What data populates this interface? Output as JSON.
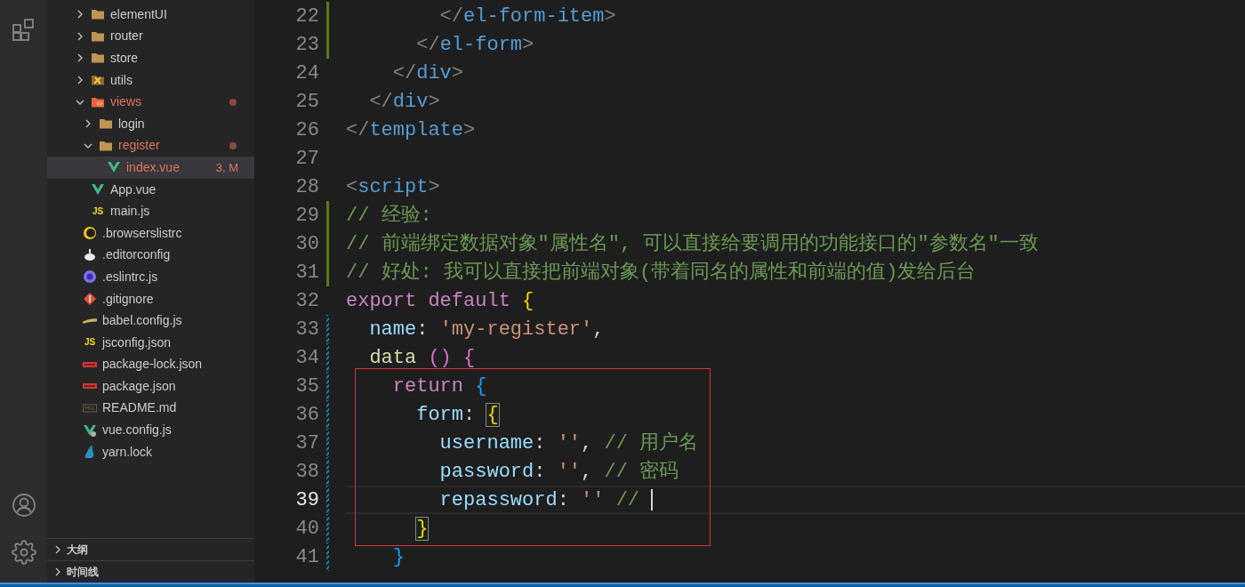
{
  "explorer": {
    "tree": [
      {
        "children": [
          {
            "name": "elementUI",
            "kind": "folder",
            "expanded": false,
            "selected": false,
            "has_problems": false
          },
          {
            "name": "router",
            "kind": "folder",
            "expanded": false,
            "selected": false,
            "has_problems": false
          },
          {
            "name": "store",
            "kind": "folder",
            "expanded": false,
            "selected": false,
            "has_problems": false
          },
          {
            "name": "utils",
            "kind": "tools-folder",
            "expanded": false,
            "selected": false,
            "has_problems": false
          },
          {
            "name": "views",
            "kind": "views-folder",
            "expanded": true,
            "selected": false,
            "has_problems": true,
            "children": [
              {
                "name": "login",
                "kind": "folder",
                "expanded": false,
                "selected": false,
                "has_problems": false
              },
              {
                "name": "register",
                "kind": "folder",
                "expanded": true,
                "selected": false,
                "has_problems": true,
                "children": [
                  {
                    "name": "index.vue",
                    "kind": "vue",
                    "selected": true,
                    "has_problems": true,
                    "badge": "3, M"
                  }
                ]
              }
            ]
          },
          {
            "name": "App.vue",
            "kind": "vue",
            "selected": false,
            "has_problems": false
          },
          {
            "name": "main.js",
            "kind": "js",
            "icon_label": "JS",
            "selected": false,
            "has_problems": false
          }
        ]
      },
      {
        "name": ".browserslistrc",
        "kind": "browserslist",
        "selected": false,
        "has_problems": false
      },
      {
        "name": ".editorconfig",
        "kind": "editorconfig",
        "selected": false,
        "has_problems": false
      },
      {
        "name": ".eslintrc.js",
        "kind": "eslint",
        "selected": false,
        "has_problems": false
      },
      {
        "name": ".gitignore",
        "kind": "git",
        "selected": false,
        "has_problems": false
      },
      {
        "name": "babel.config.js",
        "kind": "babel",
        "selected": false,
        "has_problems": false
      },
      {
        "name": "jsconfig.json",
        "kind": "js",
        "icon_label": "JS",
        "selected": false,
        "has_problems": false
      },
      {
        "name": "package-lock.json",
        "kind": "npm",
        "selected": false,
        "has_problems": false
      },
      {
        "name": "package.json",
        "kind": "npm",
        "selected": false,
        "has_problems": false
      },
      {
        "name": "README.md",
        "kind": "markdown",
        "selected": false,
        "has_problems": false
      },
      {
        "name": "vue.config.js",
        "kind": "vue-config",
        "selected": false,
        "has_problems": false
      },
      {
        "name": "yarn.lock",
        "kind": "yarn",
        "selected": false,
        "has_problems": false
      }
    ],
    "sections": [
      {
        "title": "大纲",
        "expanded": false
      },
      {
        "title": "时间线",
        "expanded": false
      }
    ]
  },
  "editor": {
    "lines": [
      {
        "number": "22",
        "added": true,
        "modified": false,
        "current": false,
        "boxed": false,
        "tokens": [
          {
            "t": "        </",
            "kind": "punct"
          },
          {
            "t": "el-form-item",
            "kind": "tag"
          },
          {
            "t": ">",
            "kind": "punct"
          }
        ]
      },
      {
        "number": "23",
        "added": true,
        "modified": false,
        "current": false,
        "boxed": false,
        "tokens": [
          {
            "t": "      </",
            "kind": "punct"
          },
          {
            "t": "el-form",
            "kind": "tag"
          },
          {
            "t": ">",
            "kind": "punct"
          }
        ]
      },
      {
        "number": "24",
        "added": false,
        "modified": false,
        "current": false,
        "boxed": false,
        "tokens": [
          {
            "t": "    </",
            "kind": "punct"
          },
          {
            "t": "div",
            "kind": "tag"
          },
          {
            "t": ">",
            "kind": "punct"
          }
        ]
      },
      {
        "number": "25",
        "added": false,
        "modified": false,
        "current": false,
        "boxed": false,
        "tokens": [
          {
            "t": "  </",
            "kind": "punct"
          },
          {
            "t": "div",
            "kind": "tag"
          },
          {
            "t": ">",
            "kind": "punct"
          }
        ]
      },
      {
        "number": "26",
        "added": false,
        "modified": false,
        "current": false,
        "boxed": false,
        "tokens": [
          {
            "t": "</",
            "kind": "punct"
          },
          {
            "t": "template",
            "kind": "tag"
          },
          {
            "t": ">",
            "kind": "punct"
          }
        ]
      },
      {
        "number": "27",
        "added": false,
        "modified": false,
        "current": false,
        "boxed": false
      },
      {
        "number": "28",
        "added": false,
        "modified": false,
        "current": false,
        "boxed": false,
        "tokens": [
          {
            "t": "<",
            "kind": "punct"
          },
          {
            "t": "script",
            "kind": "tag"
          },
          {
            "t": ">",
            "kind": "punct"
          }
        ]
      },
      {
        "number": "29",
        "added": true,
        "modified": false,
        "current": false,
        "boxed": false,
        "tokens": [
          {
            "t": "// 经验:",
            "kind": "comment"
          }
        ]
      },
      {
        "number": "30",
        "added": true,
        "modified": false,
        "current": false,
        "boxed": false,
        "tokens": [
          {
            "t": "// 前端绑定数据对象\"属性名\", 可以直接给要调用的功能接口的\"参数名\"一致",
            "kind": "comment"
          }
        ]
      },
      {
        "number": "31",
        "added": true,
        "modified": false,
        "current": false,
        "boxed": false,
        "tokens": [
          {
            "t": "// 好处: 我可以直接把前端对象(带着同名的属性和前端的值)发给后台",
            "kind": "comment"
          }
        ]
      },
      {
        "number": "32",
        "added": false,
        "modified": false,
        "current": false,
        "boxed": false,
        "tokens": [
          {
            "t": "export default",
            "kind": "keyword"
          },
          {
            "t": " {",
            "kind": "brace1"
          }
        ]
      },
      {
        "number": "33",
        "added": false,
        "modified": true,
        "current": false,
        "boxed": false,
        "tokens": [
          {
            "t": "  name",
            "kind": "prop"
          },
          {
            "t": ": ",
            "kind": "plain"
          },
          {
            "t": "'my-register'",
            "kind": "string"
          },
          {
            "t": ",",
            "kind": "plain"
          }
        ]
      },
      {
        "number": "34",
        "added": false,
        "modified": true,
        "current": false,
        "boxed": false,
        "tokens": [
          {
            "t": "  data",
            "kind": "func"
          },
          {
            "t": " () {",
            "kind": "brace2"
          }
        ]
      },
      {
        "number": "35",
        "added": false,
        "modified": true,
        "current": false,
        "boxed": true,
        "tokens": [
          {
            "t": "    return",
            "kind": "keyword"
          },
          {
            "t": " {",
            "kind": "brace3"
          }
        ]
      },
      {
        "number": "36",
        "added": false,
        "modified": true,
        "current": false,
        "boxed": true,
        "tokens": [
          {
            "t": "      form",
            "kind": "prop"
          },
          {
            "t": ": ",
            "kind": "plain"
          },
          {
            "t": "{",
            "kind": "brace1-match"
          }
        ]
      },
      {
        "number": "37",
        "added": false,
        "modified": true,
        "current": false,
        "boxed": true,
        "tokens": [
          {
            "t": "        username",
            "kind": "prop"
          },
          {
            "t": ": ",
            "kind": "plain"
          },
          {
            "t": "''",
            "kind": "string"
          },
          {
            "t": ", ",
            "kind": "plain"
          },
          {
            "t": "// 用户名",
            "kind": "comment"
          }
        ]
      },
      {
        "number": "38",
        "added": false,
        "modified": true,
        "current": false,
        "boxed": true,
        "tokens": [
          {
            "t": "        password",
            "kind": "prop"
          },
          {
            "t": ": ",
            "kind": "plain"
          },
          {
            "t": "''",
            "kind": "string"
          },
          {
            "t": ", ",
            "kind": "plain"
          },
          {
            "t": "// 密码",
            "kind": "comment"
          }
        ]
      },
      {
        "number": "39",
        "added": false,
        "modified": true,
        "current": true,
        "boxed": true,
        "tokens": [
          {
            "t": "        repassword",
            "kind": "prop"
          },
          {
            "t": ": ",
            "kind": "plain"
          },
          {
            "t": "''",
            "kind": "string"
          },
          {
            "t": " // ",
            "kind": "comment"
          }
        ]
      },
      {
        "number": "40",
        "added": false,
        "modified": true,
        "current": false,
        "boxed": true,
        "tokens": [
          {
            "t": "      }",
            "kind": "brace1-match"
          }
        ]
      },
      {
        "number": "41",
        "added": false,
        "modified": true,
        "current": false,
        "boxed": false,
        "tokens": [
          {
            "t": "    }",
            "kind": "brace3"
          }
        ]
      }
    ]
  }
}
